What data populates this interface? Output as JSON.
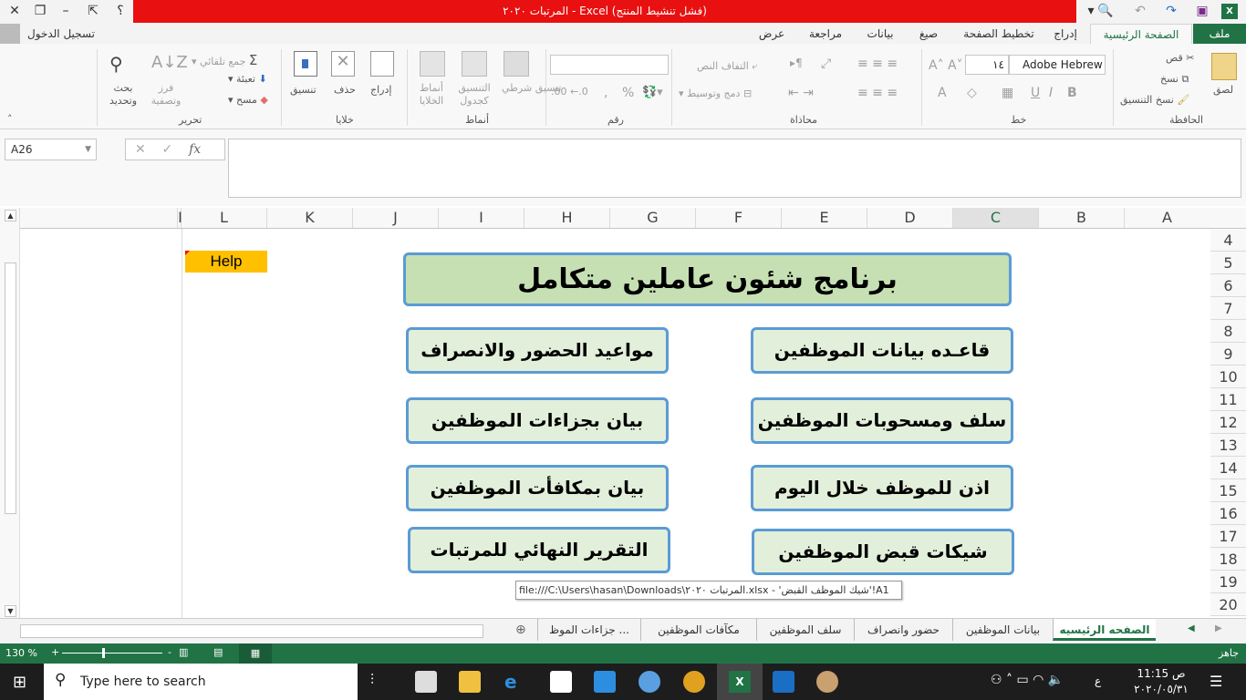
{
  "window": {
    "title": "المرتبات ٢٠٢٠ - Excel (فشل تنشيط المنتج)",
    "help": "؟",
    "signin": "تسجيل الدخول"
  },
  "tabs": [
    "ملف",
    "الصفحة الرئيسية",
    "إدراج",
    "تخطيط الصفحة",
    "صيغ",
    "بيانات",
    "مراجعة",
    "عرض"
  ],
  "ribbon": {
    "clipboard": {
      "label": "الحافظة",
      "paste": "لصق",
      "cut": "قص",
      "copy": "نسخ",
      "format_painter": "نسخ التنسيق"
    },
    "font": {
      "label": "خط",
      "font_name": "Adobe Hebrew",
      "font_size": "١٤",
      "bold": "B",
      "italic": "I",
      "underline": "U"
    },
    "alignment": {
      "label": "محاذاة",
      "wrap": "التفاف النص",
      "merge": "دمج وتوسيط"
    },
    "number": {
      "label": "رقم",
      "percent": "%",
      "comma": ","
    },
    "styles": {
      "label": "أنماط",
      "conditional": "تنسيق شرطي",
      "table": "التنسيق كجدول",
      "cell_styles": "أنماط الخلايا"
    },
    "cells": {
      "label": "خلايا",
      "insert": "إدراج",
      "delete": "حذف",
      "format": "تنسيق"
    },
    "editing": {
      "label": "تحرير",
      "autosum": "جمع تلقائي",
      "fill": "تعبئة",
      "clear": "مسح",
      "sort": "فرز وتصفية",
      "find": "بحث وتحديد"
    }
  },
  "formula_bar": {
    "name_box": "A26",
    "fx": "fx",
    "value": ""
  },
  "columns": [
    "A",
    "B",
    "C",
    "D",
    "E",
    "F",
    "G",
    "H",
    "I",
    "J",
    "K",
    "L",
    "I"
  ],
  "rows": [
    "4",
    "5",
    "6",
    "7",
    "8",
    "9",
    "10",
    "11",
    "12",
    "13",
    "14",
    "15",
    "16",
    "17",
    "18",
    "19",
    "20"
  ],
  "sheet": {
    "help": "Help",
    "title": "برنامج شئون عاملين متكامل",
    "buttons_right": [
      "قاعـده بيانات الموظفين",
      "سلف ومسحوبات الموظفين",
      "اذن للموظف خلال اليوم",
      "شيكات قبض الموظفين"
    ],
    "buttons_left": [
      "مواعيد الحضور والانصراف",
      "بيان بجزاءات الموظفين",
      "بيان بمكافأت الموظفين",
      "التقرير النهائي للمرتبات"
    ],
    "tooltip": "file:///C:\\Users\\hasan\\Downloads\\المرتبات ٢٠٢٠.xlsx - 'شيك الموظف القبض'!A1"
  },
  "sheet_tabs": [
    "الصفحه الرئيسيه",
    "بيانات الموظفين",
    "حضور وانصراف",
    "سلف الموظفين",
    "مكآفات الموظفين",
    "جزاءات الموظ ..."
  ],
  "status": {
    "ready": "جاهز",
    "zoom": "130 %"
  },
  "taskbar": {
    "search_placeholder": "Type here to search",
    "time": "11:15 ص",
    "date": "٢٠٢٠/٠٥/٣١",
    "lang": "ع"
  },
  "colors": {
    "excel_green": "#217346",
    "title_red": "#e81010",
    "button_fill": "#e2efda",
    "title_fill": "#c6e0b4",
    "button_border": "#5b9bd5",
    "help_fill": "#ffc000"
  }
}
